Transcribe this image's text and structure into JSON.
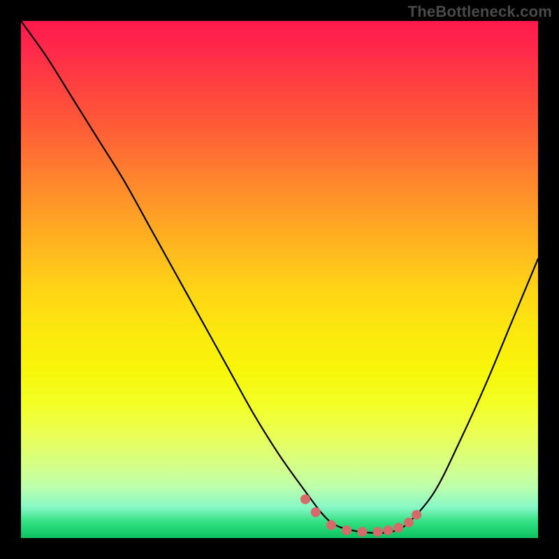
{
  "watermark": "TheBottleneck.com",
  "colors": {
    "page_bg": "#000000",
    "curve": "#000000",
    "dots": "#d46a6a",
    "gradient_top": "#ff1a4d",
    "gradient_bottom": "#0cc060"
  },
  "chart_data": {
    "type": "line",
    "title": "",
    "xlabel": "",
    "ylabel": "",
    "xlim": [
      0,
      100
    ],
    "ylim": [
      0,
      100
    ],
    "grid": false,
    "legend": false,
    "note": "Interpolated V-shaped bottleneck curve; y is bottleneck/mismatch percentage (100 = worst, 0 = best). Values estimated from pixel positions — no axis ticks or data labels are present in the source image.",
    "series": [
      {
        "name": "bottleneck-curve",
        "x": [
          0,
          5,
          10,
          15,
          20,
          25,
          30,
          35,
          40,
          45,
          50,
          55,
          58,
          60,
          62,
          65,
          68,
          70,
          72,
          75,
          80,
          85,
          90,
          95,
          100
        ],
        "y": [
          100,
          93,
          85,
          77,
          69,
          60,
          51,
          42,
          33,
          24,
          16,
          9,
          5,
          3,
          2,
          1.3,
          1,
          1,
          1.3,
          3,
          9,
          19,
          30,
          42,
          54
        ]
      }
    ],
    "highlight_points": {
      "name": "optimal-range-dots",
      "x": [
        55,
        57,
        60,
        63,
        66,
        69,
        71,
        73,
        75,
        76.5
      ],
      "y": [
        7.5,
        5,
        2.5,
        1.5,
        1.2,
        1.2,
        1.5,
        2,
        3,
        4.5
      ]
    }
  }
}
